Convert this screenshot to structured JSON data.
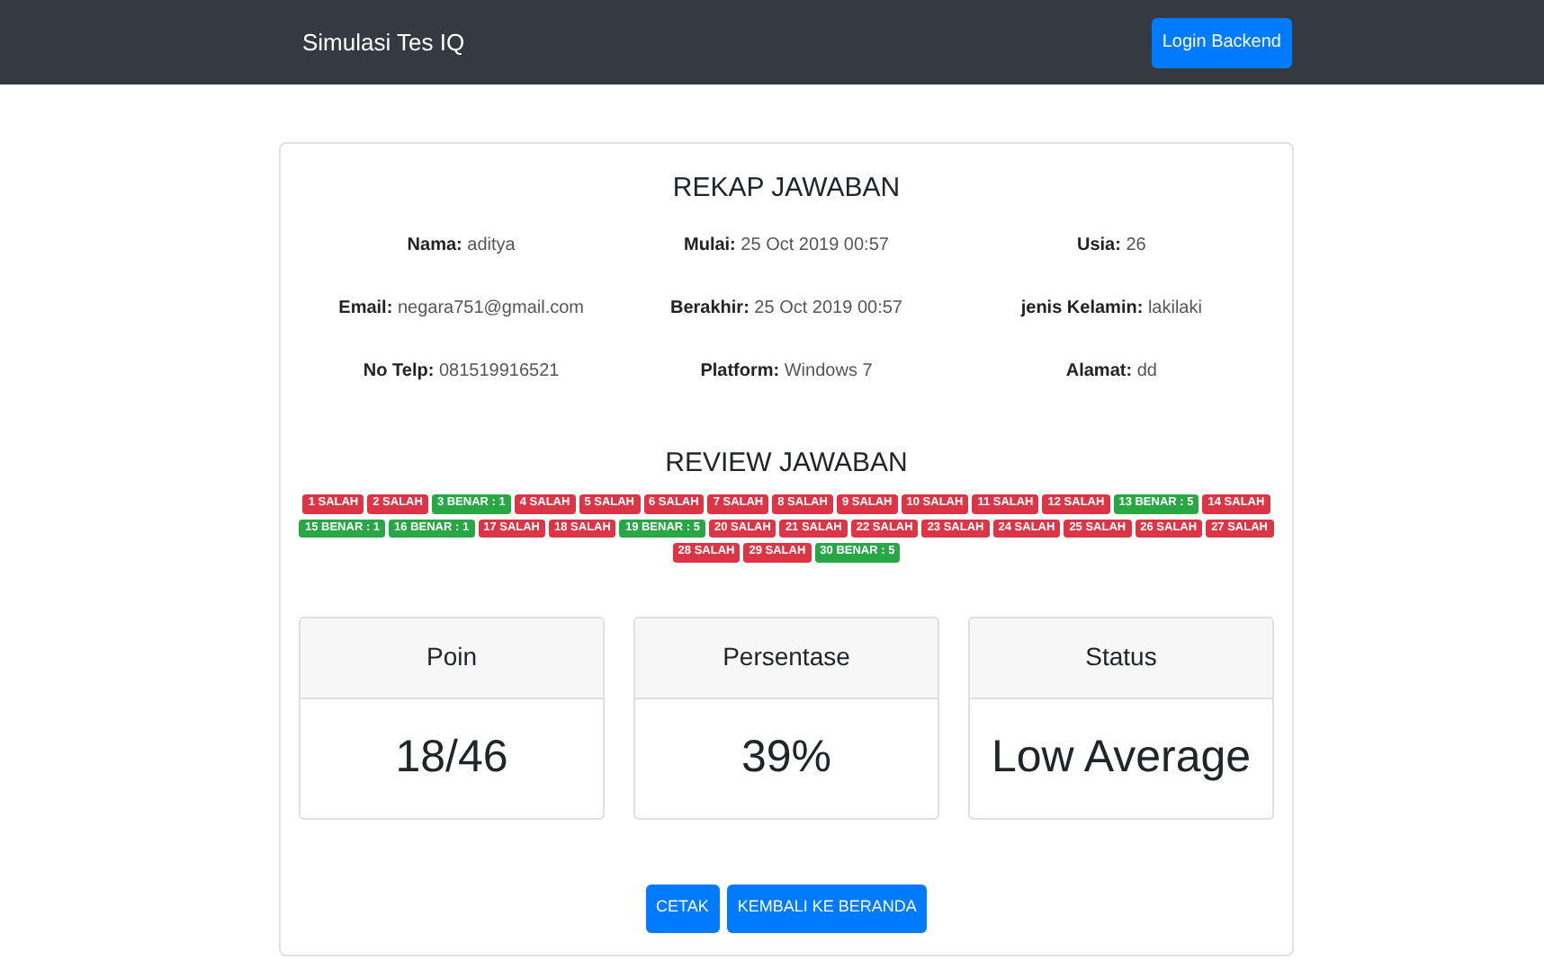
{
  "navbar": {
    "brand": "Simulasi Tes IQ",
    "login_button": "Login Backend"
  },
  "rekap": {
    "title": "REKAP JAWABAN",
    "fields": [
      {
        "label": "Nama:",
        "value": "aditya"
      },
      {
        "label": "Mulai:",
        "value": "25 Oct 2019 00:57"
      },
      {
        "label": "Usia:",
        "value": "26"
      },
      {
        "label": "Email:",
        "value": "negara751@gmail.com"
      },
      {
        "label": "Berakhir:",
        "value": "25 Oct 2019 00:57"
      },
      {
        "label": "jenis Kelamin:",
        "value": "lakilaki"
      },
      {
        "label": "No Telp:",
        "value": "081519916521"
      },
      {
        "label": "Platform:",
        "value": "Windows 7"
      },
      {
        "label": "Alamat:",
        "value": "dd"
      }
    ]
  },
  "review": {
    "title": "REVIEW JAWABAN",
    "answers": [
      {
        "label": "1 SALAH",
        "correct": false
      },
      {
        "label": "2 SALAH",
        "correct": false
      },
      {
        "label": "3 BENAR : 1",
        "correct": true
      },
      {
        "label": "4 SALAH",
        "correct": false
      },
      {
        "label": "5 SALAH",
        "correct": false
      },
      {
        "label": "6 SALAH",
        "correct": false
      },
      {
        "label": "7 SALAH",
        "correct": false
      },
      {
        "label": "8 SALAH",
        "correct": false
      },
      {
        "label": "9 SALAH",
        "correct": false
      },
      {
        "label": "10 SALAH",
        "correct": false
      },
      {
        "label": "11 SALAH",
        "correct": false
      },
      {
        "label": "12 SALAH",
        "correct": false
      },
      {
        "label": "13 BENAR : 5",
        "correct": true
      },
      {
        "label": "14 SALAH",
        "correct": false
      },
      {
        "label": "15 BENAR : 1",
        "correct": true
      },
      {
        "label": "16 BENAR : 1",
        "correct": true
      },
      {
        "label": "17 SALAH",
        "correct": false
      },
      {
        "label": "18 SALAH",
        "correct": false
      },
      {
        "label": "19 BENAR : 5",
        "correct": true
      },
      {
        "label": "20 SALAH",
        "correct": false
      },
      {
        "label": "21 SALAH",
        "correct": false
      },
      {
        "label": "22 SALAH",
        "correct": false
      },
      {
        "label": "23 SALAH",
        "correct": false
      },
      {
        "label": "24 SALAH",
        "correct": false
      },
      {
        "label": "25 SALAH",
        "correct": false
      },
      {
        "label": "26 SALAH",
        "correct": false
      },
      {
        "label": "27 SALAH",
        "correct": false
      },
      {
        "label": "28 SALAH",
        "correct": false
      },
      {
        "label": "29 SALAH",
        "correct": false
      },
      {
        "label": "30 BENAR : 5",
        "correct": true
      }
    ]
  },
  "results": [
    {
      "heading": "Poin",
      "value": "18/46"
    },
    {
      "heading": "Persentase",
      "value": "39%"
    },
    {
      "heading": "Status",
      "value": "Low Average"
    }
  ],
  "buttons": [
    "CETAK",
    "KEMBALI KE BERANDA"
  ]
}
